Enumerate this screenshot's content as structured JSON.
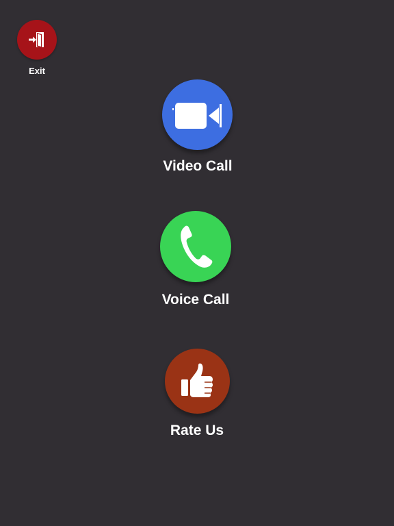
{
  "exit": {
    "label": "Exit",
    "icon": "door-exit-icon",
    "color": "#a61319"
  },
  "actions": {
    "video_call": {
      "label": "Video Call",
      "icon": "video-camera-icon",
      "color": "#3d6ee1"
    },
    "voice_call": {
      "label": "Voice Call",
      "icon": "phone-handset-icon",
      "color": "#39d455"
    },
    "rate_us": {
      "label": "Rate Us",
      "icon": "thumbs-up-icon",
      "color": "#9a3315"
    }
  },
  "background_color": "#312e33"
}
